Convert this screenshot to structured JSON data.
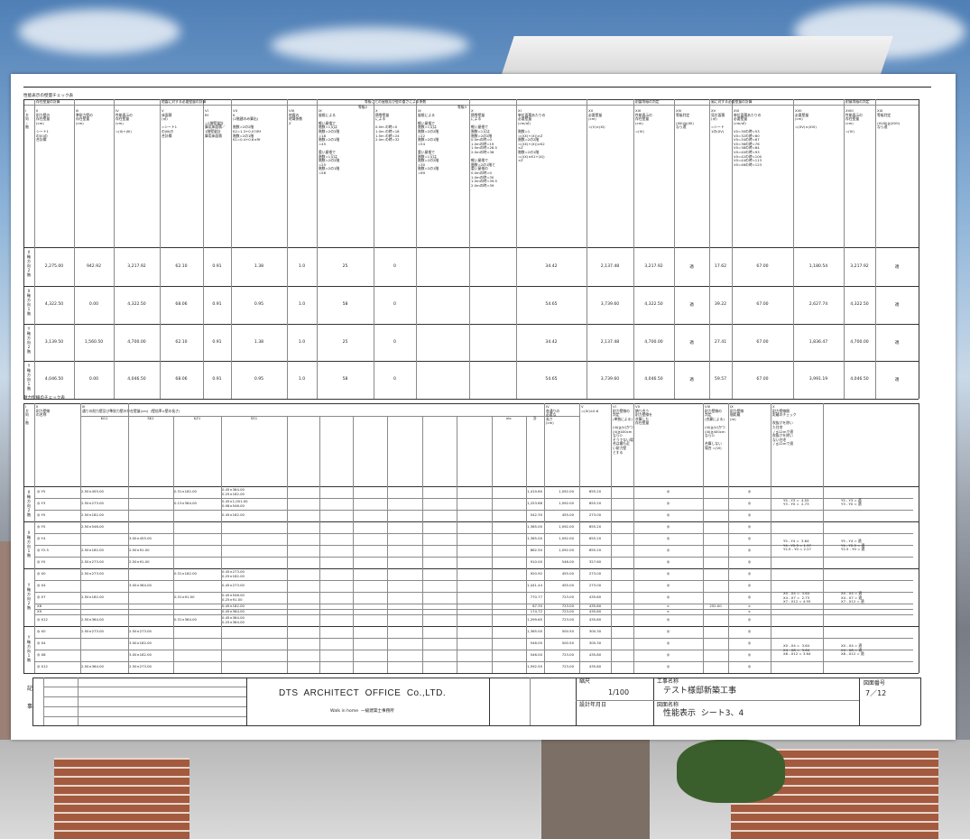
{
  "sheet1": {
    "title": "性能表示の壁量チェック表",
    "groups": [
      "存在壁量の計算",
      "地震に対する必要壁量の計算",
      "等級ごとの屋根及び壁の重さによる係数",
      "耐震等級の判定",
      "風に対する必要壁量の計算",
      "耐風等級の判定"
    ],
    "grade_labels": [
      "等級2",
      "等級3"
    ],
    "headers": [
      "I\n方\n向\n・\n階",
      "II\n耐力壁の\n存在壁量\n(cm)\n\nシート1\nの(II)の\n合計欄",
      "III\n準耐力壁の\n存在壁量\n(cm)",
      "IV\n性能表示の\n存在壁量\n(cm)\n\n=(II)+(III)",
      "V\n床面積\n(㎡)\n\n=シート1\nの(Ⅲ)の\n合計欄",
      "VI\nRf\n\n=2階壁量計\n算用床面積／\n1階壁量計\n算用床面積",
      "VII\nK\n(2階建のみ算出)\n\n階数=2の2階\nK2=1.3+0.07/Rf\n階数=2の1階\nK1=0.4+0.6×Rf",
      "VIII\n地震の\n地域係数\nZ",
      "IX\n屋根による\n\n軽い屋根で\n階数=1又は\n階数=2の2階\n=18\n階数=2の1階\n=45\n\n重い屋根で\n階数=1又は\n階数=2の2階\n=25\n階数=2の1階\n=58",
      "X\n積雪壁量\nによる\n\n0.0m の時=0\n1.0m の時=18\n1.5m の時=24\n2.0m の時=32",
      "IX\n屋根による\n\n軽い屋根で\n階数=1又は\n階数=2の2階\n=22\n階数=2の1階\n=54\n\n重い屋根で\n階数=1又は\n階数=2の2階\n=30\n階数=2の1階\n=69",
      "X\n積雪壁量\nによる\n\n軽い屋根で\n階数=1又は\n階数=2の2階\n0.0mの時=0\n1.0mの時=19\n1.5mの時=28.5\n2.0mの時=38\n\n軽い屋根で\n階数=2の1階と\n重い屋根の\n0.0mの時=0\n1.0mの時=30\n1.5mの時=39.5\n2.0mの時=39",
      "XI\n単位面積あたりの\n必要壁量\n(cm/㎡)\n\n階数=1\n=((IX)+(X))×Z\n階数=2の2階\n=((IX)+(X))×K2\n×Z\n階数=2の1階\n=((IX)×K1+(X))\n×Z",
      "XII\n必要壁量\n(cm)\n\n=(V)×(XI)",
      "XIII\n性能表示の\n存在壁量\n(cm)\n\n=(IV)",
      "XIV\n等級判定\n\n(XIII)≧(XII)\nなら適",
      "XV\n見付面積\n(㎡)\n\n=シート\n1の(XV)",
      "XVI\n単位面積あたりの\n必要壁量\n(cm/㎡)\n\nV0=30の時=53\nV0=32の時=60\nV0=34の時=67\nV0=36の時=76\nV0=38の時=84\nV0=40の時=93\nV0=42の時=100\nV0=44の時=113\nV0=46の時=123",
      "XVII\n必要壁量\n(cm)\n\n=(XV)×(XVI)",
      "XVIII\n性能表示の\n存在壁量\n(cm)\n\n=(IV)",
      "XIX\n等級判定\n\n(XVIII)≧(XVII)\nなら適"
    ],
    "rows": [
      {
        "label": "X\n軸\n方\n向\n2\n階",
        "cells": [
          "2,275.00",
          "942.92",
          "3,217.92",
          "62.10",
          "0.91",
          "1.38",
          "1.0",
          "25",
          "0",
          "",
          "",
          "34.42",
          "2,137.48",
          "3,217.92",
          "適",
          "17.62",
          "67.00",
          "1,180.54",
          "3,217.92",
          "適"
        ]
      },
      {
        "label": "X\n軸\n方\n向\n1\n階",
        "cells": [
          "4,322.50",
          "0.00",
          "4,322.50",
          "68.06",
          "0.91",
          "0.95",
          "1.0",
          "58",
          "0",
          "",
          "",
          "54.65",
          "3,739.60",
          "4,322.50",
          "適",
          "39.22",
          "67.00",
          "2,627.74",
          "4,322.50",
          "適"
        ]
      },
      {
        "label": "Y\n軸\n方\n向\n2\n階",
        "cells": [
          "3,139.50",
          "1,560.50",
          "4,700.00",
          "62.10",
          "0.91",
          "1.38",
          "1.0",
          "25",
          "0",
          "",
          "",
          "34.42",
          "2,137.48",
          "4,700.00",
          "適",
          "27.41",
          "67.00",
          "1,836.47",
          "4,700.00",
          "適"
        ]
      },
      {
        "label": "Y\n軸\n方\n向\n1\n階",
        "cells": [
          "4,046.50",
          "0.00",
          "4,046.50",
          "68.06",
          "0.91",
          "0.95",
          "1.0",
          "58",
          "0",
          "",
          "",
          "54.65",
          "3,739.60",
          "4,046.50",
          "適",
          "59.57",
          "67.00",
          "3,991.19",
          "4,046.50",
          "適"
        ]
      }
    ]
  },
  "sheet2": {
    "title": "耐力壁線のチェック表",
    "headers": {
      "c1": "I\n方\n向\n・\n階",
      "c2": "II\n耐力壁線\nの名称",
      "c3": "III\n通りの耐力壁及び準耐力壁の存在壁量(cm)  (壁倍率×壁の長さ)",
      "cols": [
        "KG1",
        "SK1",
        "KZ1",
        "SS1",
        "",
        "",
        "",
        "",
        "",
        "",
        "etc",
        "計"
      ],
      "iv": "IV\n各通りの\n必要な\n長さ\n(cm)",
      "v": "V\n=(IV)×0.6",
      "vi": "VI\n耐力壁線の\n判定\n(単独による)\n\n(III)≧(V)かつ\n(II)≧400cm\nならO\nそうでない場\n合は最も近\nい耐力壁\nとする",
      "vii": "VII\n隣り合う\n耐力壁線を\n合算した\n存在壁量",
      "viii": "VIII\n耐力壁線の\n判定\n(合算による)\n\n(III)≧(V)かつ\n(III)≧400cm\nならO\n\n合算しない\n場合 =(VI)",
      "ix": "IX\n耐力壁線\n間距離\n(m)",
      "x": "X\n耐力壁線間\n距離のチェック\n\n吹抜けを除い\nた住宅\n / ≦12mで適\n吹抜けを除い\nない住宅\n / ≦12mで適"
    },
    "groups": [
      {
        "label": "X\n軸\n方\n向\n2\n階",
        "dist": "Y5 - Y3 =  4.55\nY3 - Y0 =  2.73",
        "check": "Y5 - Y3 = 適\nY3 - Y0 = 適",
        "rows": [
          {
            "name": "◎ Y5",
            "vals": [
              "2.50×455.00",
              "",
              "0.31×182.00",
              "0.45×364.00\n0.25×182.00"
            ],
            "sum": "1,419.60",
            "need": "1,092.00",
            "v": "655.20",
            "j1": "◎",
            "j2": "◎"
          },
          {
            "name": "◎ Y3",
            "vals": [
              "2.50×273.00",
              "",
              "0.13×364.00",
              "0.45×1,001.00\n0.08×546.00"
            ],
            "sum": "1,253.86",
            "need": "1,092.00",
            "v": "655.20",
            "j1": "◎",
            "j2": "◎"
          },
          {
            "name": "◎ Y0",
            "vals": [
              "2.50×182.00",
              "",
              "",
              "0.45×182.00"
            ],
            "sum": "542.35",
            "need": "455.00",
            "v": "273.00",
            "j1": "◎",
            "j2": "◎"
          }
        ]
      },
      {
        "label": "X\n軸\n方\n向\n1\n階",
        "dist": "Y5 - Y4 =  3.64\nY4 - Y2.5 = 1.37\nY2.5 - Y0 = 2.27",
        "check": "Y5 - Y4 = 適\nY4 - Y2.5 = 適\nY2.5 - Y0 = 適",
        "rows": [
          {
            "name": "◎ Y5",
            "vals": [
              "2.50×546.00",
              "",
              "",
              ""
            ],
            "sum": "1,365.00",
            "need": "1,092.00",
            "v": "655.20",
            "j1": "◎",
            "j2": "◎"
          },
          {
            "name": "◎ Y4",
            "vals": [
              "",
              "3.00×455.00",
              "",
              ""
            ],
            "sum": "1,365.00",
            "need": "1,092.00",
            "v": "655.20",
            "j1": "◎",
            "j2": "◎"
          },
          {
            "name": "◎ Y2.5",
            "vals": [
              "2.50×182.00",
              "2.50×91.00",
              "",
              ""
            ],
            "sum": "862.50",
            "need": "1,092.00",
            "v": "655.20",
            "j1": "◎",
            "j2": "◎"
          },
          {
            "name": "◎ Y0",
            "vals": [
              "2.50×273.00",
              "2.50×91.00",
              "",
              ""
            ],
            "sum": "910.00",
            "need": "546.00",
            "v": "327.60",
            "j1": "◎",
            "j2": "◎"
          }
        ]
      },
      {
        "label": "Y\n軸\n方\n向\n2\n階",
        "dist": "X0 - X4 =  3.64\nX4 - X7 =  2.73\nX7 - X12 = 4.55",
        "check": "X0 - X4 = 適\nX4 - X7 = 適\nX7 - X12 = 適",
        "rows": [
          {
            "name": "◎ X0",
            "vals": [
              "2.50×273.00",
              "",
              "0.31×182.00",
              "0.45×273.00\n0.25×182.00"
            ],
            "sum": "920.92",
            "need": "455.00",
            "v": "273.00",
            "j1": "◎",
            "j2": "◎"
          },
          {
            "name": "◎ X4",
            "vals": [
              "",
              "3.00×364.00",
              "",
              "0.45×273.00"
            ],
            "sum": "1,441.44",
            "need": "455.00",
            "v": "273.00",
            "j1": "◎",
            "j2": "◎"
          },
          {
            "name": "◎ X7",
            "vals": [
              "2.50×182.00",
              "",
              "0.31×91.00",
              "0.45×546.00\n0.25×91.00"
            ],
            "sum": "770.77",
            "need": "723.00",
            "v": "435.80",
            "j1": "◎",
            "j2": "◎"
          },
          {
            "name": "X8",
            "vals": [
              "",
              "",
              "",
              "0.45×182.00"
            ],
            "sum": "67.35",
            "need": "723.00",
            "v": "435.80",
            "j1": "×",
            "j2": "×",
            "seven": "252.00"
          },
          {
            "name": "X9",
            "vals": [
              "",
              "",
              "",
              "0.45×364.00"
            ],
            "sum": "174.72",
            "need": "723.00",
            "v": "435.80",
            "j1": "×",
            "j2": "×"
          },
          {
            "name": "◎ X12",
            "vals": [
              "2.50×364.00",
              "",
              "0.31×364.00",
              "0.45×364.00\n0.25×364.00"
            ],
            "sum": "1,299.65",
            "need": "723.00",
            "v": "435.80",
            "j1": "◎",
            "j2": "◎"
          }
        ]
      },
      {
        "label": "Y\n軸\n方\n向\n1\n階",
        "dist": "X0 - X4 =  3.64\nX4 - X8 =  3.64\nX8 - X12 = 3.64",
        "check": "X0 - X4 = 適\nX4 - X8 = 適\nX8 - X12 = 適",
        "rows": [
          {
            "name": "◎ X0",
            "vals": [
              "2.50×273.00",
              "2.50×273.00",
              "",
              ""
            ],
            "sum": "1,365.00",
            "need": "500.50",
            "v": "300.30",
            "j1": "◎",
            "j2": "◎"
          },
          {
            "name": "◎ X4",
            "vals": [
              "",
              "3.00×182.00",
              "",
              ""
            ],
            "sum": "546.00",
            "need": "500.50",
            "v": "300.30",
            "j1": "◎",
            "j2": "◎"
          },
          {
            "name": "◎ X8",
            "vals": [
              "",
              "3.00×182.00",
              "",
              ""
            ],
            "sum": "546.00",
            "need": "723.00",
            "v": "435.80",
            "j1": "◎",
            "j2": "◎"
          },
          {
            "name": "◎ X12",
            "vals": [
              "2.50×364.00",
              "2.50×273.00",
              "",
              ""
            ],
            "sum": "1,592.50",
            "need": "723.00",
            "v": "435.80",
            "j1": "◎",
            "j2": "◎"
          }
        ]
      }
    ]
  },
  "titleblock": {
    "ki": "記",
    "ji": "事",
    "company": "DTS  ARCHITECT  OFFICE  Co.,LTD.",
    "subtitle": "Walk in home  一級建築士事務所",
    "scale_label": "縮尺",
    "scale": "1/100",
    "date_label": "設計年月日",
    "project_label": "工事名称",
    "project": "テスト様邸新築工事",
    "drawing_label": "図面名称",
    "drawing": "性能表示  シート3、4",
    "number_label": "図面番号",
    "number": "7／12"
  }
}
